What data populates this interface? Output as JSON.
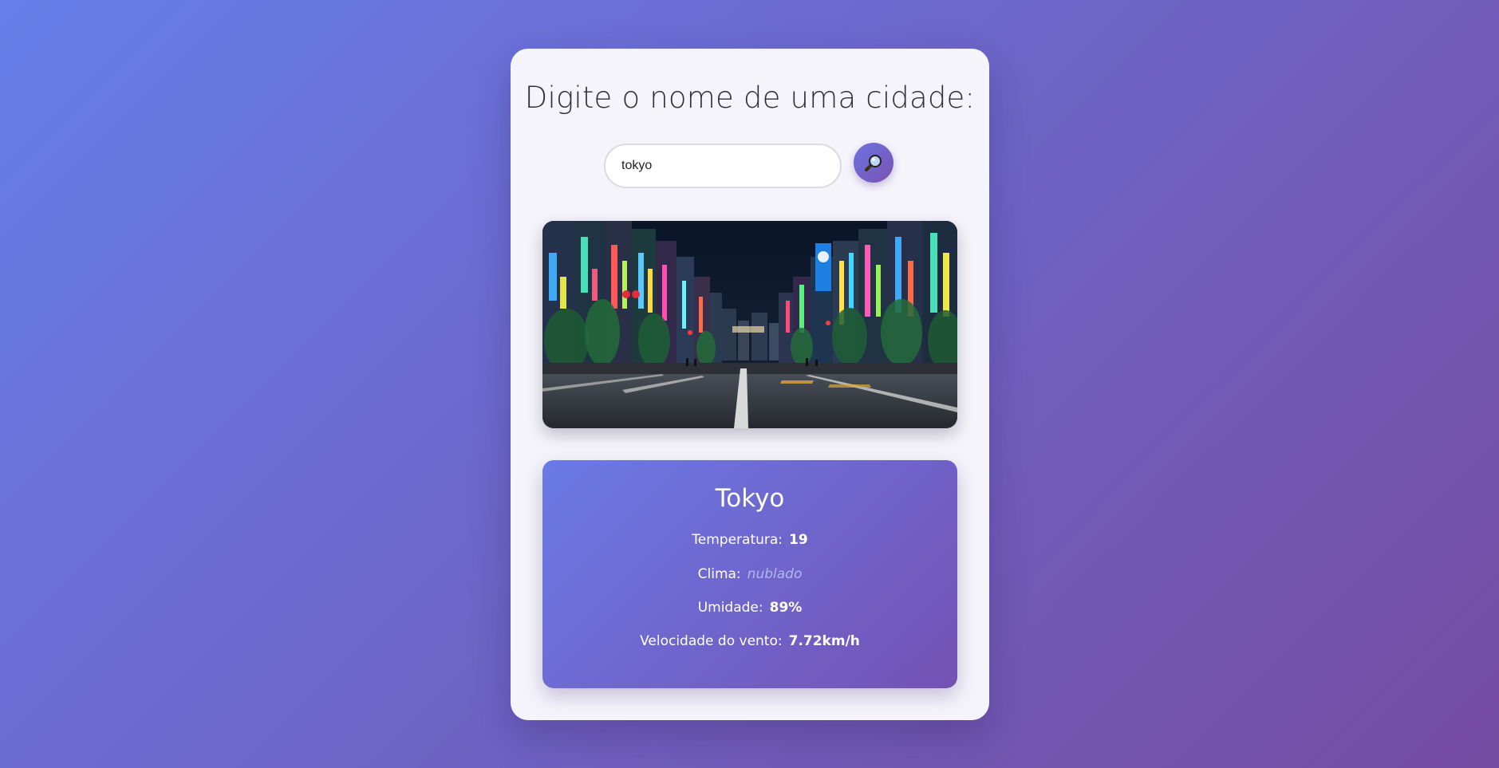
{
  "header": {
    "prompt": "Digite o nome de uma cidade:"
  },
  "search": {
    "value": "tokyo",
    "button_icon": "magnifier-icon"
  },
  "photo": {
    "subject": "city-street-photo"
  },
  "weather": {
    "city": "Tokyo",
    "temperature_label": "Temperatura:",
    "temperature_value": "19",
    "climate_label": "Clima:",
    "climate_value": "nublado",
    "humidity_label": "Umidade:",
    "humidity_value": "89%",
    "wind_label": "Velocidade do vento:",
    "wind_value": "7.72km/h"
  },
  "colors": {
    "background_start": "#667eea",
    "background_end": "#764ba2",
    "card": "#f5f4fa",
    "accent": "#7061c9"
  }
}
